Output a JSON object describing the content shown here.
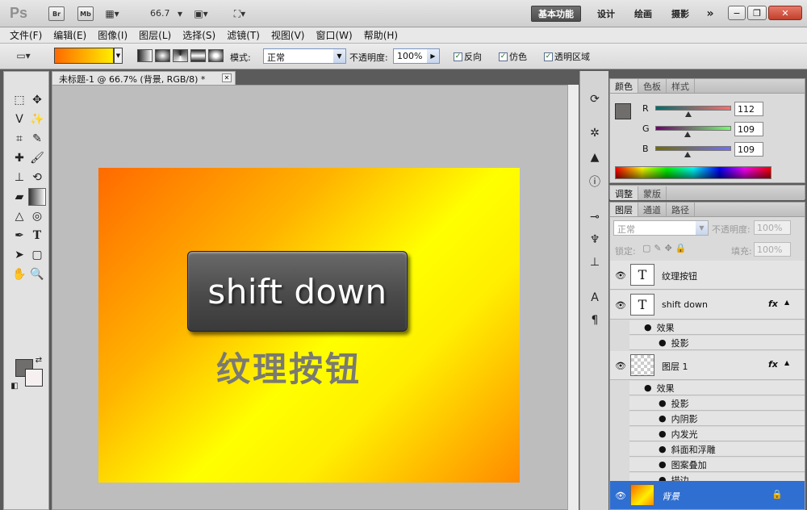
{
  "app": {
    "logo": "Ps",
    "bridge_label": "Br",
    "minibridge_label": "Mb",
    "zoom": "66.7",
    "workspaces": [
      "基本功能",
      "设计",
      "绘画",
      "摄影"
    ],
    "more_label": "»"
  },
  "menu": [
    "文件(F)",
    "编辑(E)",
    "图像(I)",
    "图层(L)",
    "选择(S)",
    "滤镜(T)",
    "视图(V)",
    "窗口(W)",
    "帮助(H)"
  ],
  "options": {
    "mode_label": "模式:",
    "mode_value": "正常",
    "opacity_label": "不透明度:",
    "opacity_value": "100%",
    "reverse_label": "反向",
    "dither_label": "仿色",
    "transparency_label": "透明区域"
  },
  "document": {
    "tab_title": "未标题-1 @ 66.7% (背景, RGB/8) *",
    "button_text": "shift down",
    "caption_text": "纹理按钮"
  },
  "color_panel": {
    "tabs": [
      "颜色",
      "色板",
      "样式"
    ],
    "channels": [
      {
        "label": "R",
        "value": "112",
        "fraction": 0.44
      },
      {
        "label": "G",
        "value": "109",
        "fraction": 0.43
      },
      {
        "label": "B",
        "value": "109",
        "fraction": 0.43
      }
    ],
    "foreground": "#706d6d",
    "background": "#f7f0f0"
  },
  "adjust_panel": {
    "tabs": [
      "调整",
      "蒙版"
    ]
  },
  "layers_panel": {
    "tabs": [
      "图层",
      "通道",
      "路径"
    ],
    "blend_mode": "正常",
    "opacity_label": "不透明度:",
    "opacity_value": "100%",
    "lock_label": "锁定:",
    "fill_label": "填充:",
    "fill_value": "100%",
    "layers": [
      {
        "name": "纹理按钮",
        "thumb": "T"
      },
      {
        "name": "shift down",
        "thumb": "T",
        "fx": "fx",
        "effects_label": "效果",
        "effects": [
          "投影"
        ]
      },
      {
        "name": "图层 1",
        "fx": "fx",
        "effects_label": "效果",
        "effects": [
          "投影",
          "内阴影",
          "内发光",
          "斜面和浮雕",
          "图案叠加",
          "描边"
        ]
      },
      {
        "name": "背景"
      }
    ]
  }
}
